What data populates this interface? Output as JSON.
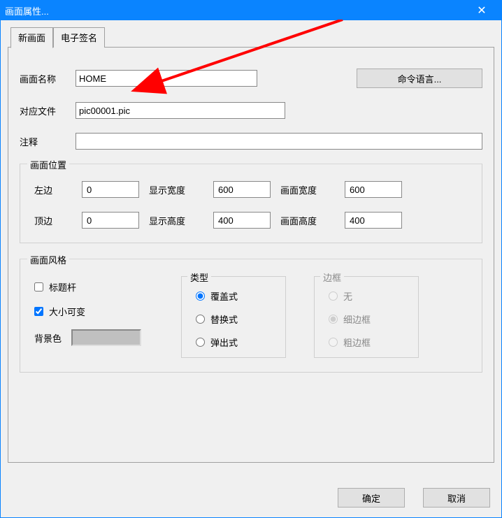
{
  "window": {
    "title": "画面属性...",
    "close_glyph": "✕"
  },
  "tabs": {
    "new_screen": "新画面",
    "esign": "电子签名"
  },
  "labels": {
    "screen_name": "画面名称",
    "file": "对应文件",
    "comment": "注释",
    "cmd_lang": "命令语言...",
    "position_group": "画面位置",
    "left": "左边",
    "top": "顶边",
    "disp_w": "显示宽度",
    "disp_h": "显示高度",
    "pic_w": "画面宽度",
    "pic_h": "画面高度",
    "style_group": "画面风格",
    "titlebar": "标题杆",
    "resizable": "大小可变",
    "bg": "背景色",
    "type_group": "类型",
    "type_overlay": "覆盖式",
    "type_replace": "替换式",
    "type_popup": "弹出式",
    "border_group": "边框",
    "border_none": "无",
    "border_thin": "细边框",
    "border_thick": "粗边框",
    "ok": "确定",
    "cancel": "取消"
  },
  "values": {
    "screen_name": "HOME",
    "file": "pic00001.pic",
    "comment": "",
    "left": "0",
    "top": "0",
    "disp_w": "600",
    "disp_h": "400",
    "pic_w": "600",
    "pic_h": "400",
    "titlebar_checked": false,
    "resizable_checked": true,
    "type_selected": "overlay",
    "border_selected": "thin",
    "bg_color": "#c0c0c0"
  },
  "annotation": {
    "arrow_color": "#ff0000"
  }
}
